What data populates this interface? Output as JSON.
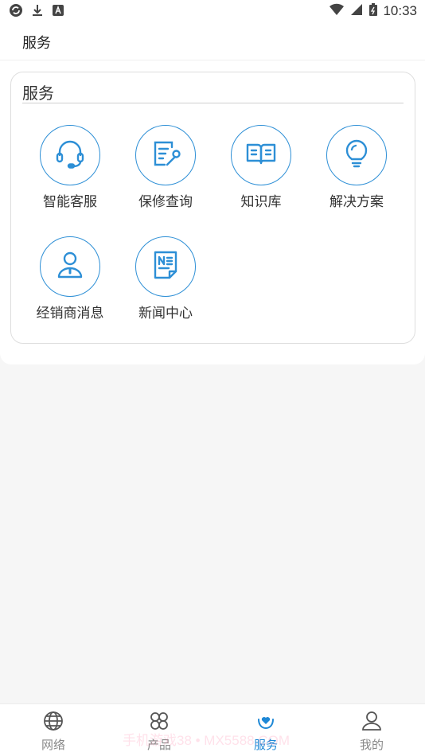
{
  "status": {
    "time": "10:33"
  },
  "header": {
    "title": "服务"
  },
  "card": {
    "title": "服务",
    "items": [
      {
        "label": "智能客服",
        "icon": "headset-icon"
      },
      {
        "label": "保修查询",
        "icon": "repair-form-icon"
      },
      {
        "label": "知识库",
        "icon": "book-icon"
      },
      {
        "label": "解决方案",
        "icon": "lightbulb-icon"
      },
      {
        "label": "经销商消息",
        "icon": "dealer-person-icon"
      },
      {
        "label": "新闻中心",
        "icon": "news-icon"
      }
    ]
  },
  "nav": {
    "items": [
      {
        "label": "网络",
        "icon": "globe-icon"
      },
      {
        "label": "产品",
        "icon": "products-icon"
      },
      {
        "label": "服务",
        "icon": "service-heart-icon",
        "active": true
      },
      {
        "label": "我的",
        "icon": "user-icon"
      }
    ]
  },
  "watermark": "手机游戏38 • MX5588.COM",
  "colors": {
    "accent": "#2d8fd6",
    "nav_active": "#1e88d6",
    "background": "#f6f6f6"
  }
}
